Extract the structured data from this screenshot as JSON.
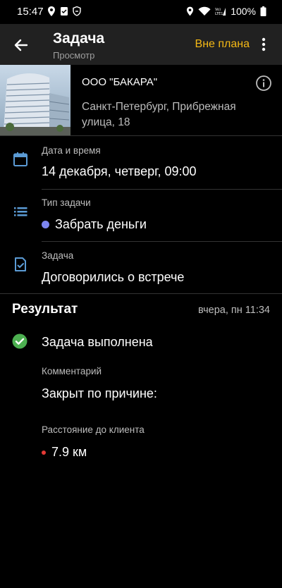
{
  "status_bar": {
    "time": "15:47",
    "battery": "100%"
  },
  "app_bar": {
    "title": "Задача",
    "subtitle": "Просмотр",
    "action_label": "Вне плана"
  },
  "client": {
    "name": "ООО \"БАКАРА\"",
    "address": "Санкт-Петербург,  Прибрежная улица, 18"
  },
  "fields": {
    "datetime": {
      "label": "Дата и время",
      "value": "14 декабря, четверг, 09:00"
    },
    "task_type": {
      "label": "Тип задачи",
      "value": "Забрать деньги",
      "dot_color": "#7d86f0"
    },
    "task": {
      "label": "Задача",
      "value": "Договорились о встрече"
    }
  },
  "result": {
    "title": "Результат",
    "time": "вчера, пн 11:34",
    "status": "Задача выполнена",
    "status_color": "#4caf50",
    "comment_label": "Комментарий",
    "comment": "Закрыт по причине:",
    "distance_label": "Расстояние до клиента",
    "distance": "7.9 км",
    "distance_dot_color": "#e53935"
  },
  "colors": {
    "accent": "#f5b915",
    "icon_blue": "#5b9bd5",
    "app_bar_bg": "#212121"
  }
}
